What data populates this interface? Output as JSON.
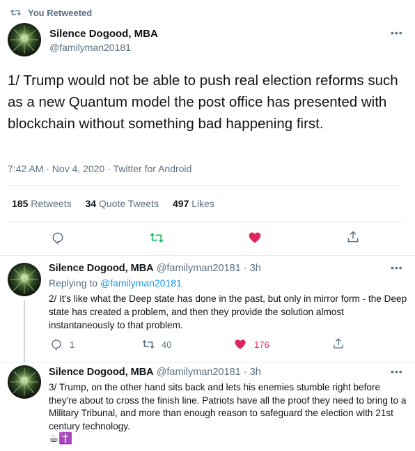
{
  "retweet_header": {
    "label": "You Retweeted"
  },
  "main_tweet": {
    "name": "Silence Dogood, MBA",
    "handle": "@familyman20181",
    "text": "1/ Trump would not be able to push real election reforms such as a new Quantum model the post office has presented with blockchain without something bad happening first.",
    "meta": "7:42 AM · Nov 4, 2020 · Twitter for Android",
    "stats": {
      "retweets_count": "185",
      "retweets_label": "Retweets",
      "quotes_count": "34",
      "quotes_label": "Quote Tweets",
      "likes_count": "497",
      "likes_label": "Likes"
    }
  },
  "replies": [
    {
      "name": "Silence Dogood, MBA",
      "handle": "@familyman20181",
      "time": "3h",
      "replying_to_label": "Replying to",
      "replying_to_handle": "@familyman20181",
      "text": "2/ It's like what the Deep state has done in the past, but only in mirror form - the Deep state has created a problem, and then they provide the solution almost instantaneously to that problem.",
      "reply_count": "1",
      "retweet_count": "40",
      "like_count": "176"
    },
    {
      "name": "Silence Dogood, MBA",
      "handle": "@familyman20181",
      "time": "3h",
      "text": "3/ Trump, on the other hand sits back and lets his enemies stumble right before they're about to cross the finish line. Patriots have all the proof they need to bring to a Military Tribunal, and more than enough reason to safeguard the election with 21st century technology.",
      "emoji": "☕✝️"
    }
  ],
  "colors": {
    "retweet_green": "#17bf63",
    "like_red": "#e0245e",
    "link_blue": "#1b95e0",
    "muted": "#5b7083"
  },
  "icons": [
    "retweet-icon",
    "more-icon",
    "reply-icon",
    "like-icon",
    "share-icon"
  ]
}
